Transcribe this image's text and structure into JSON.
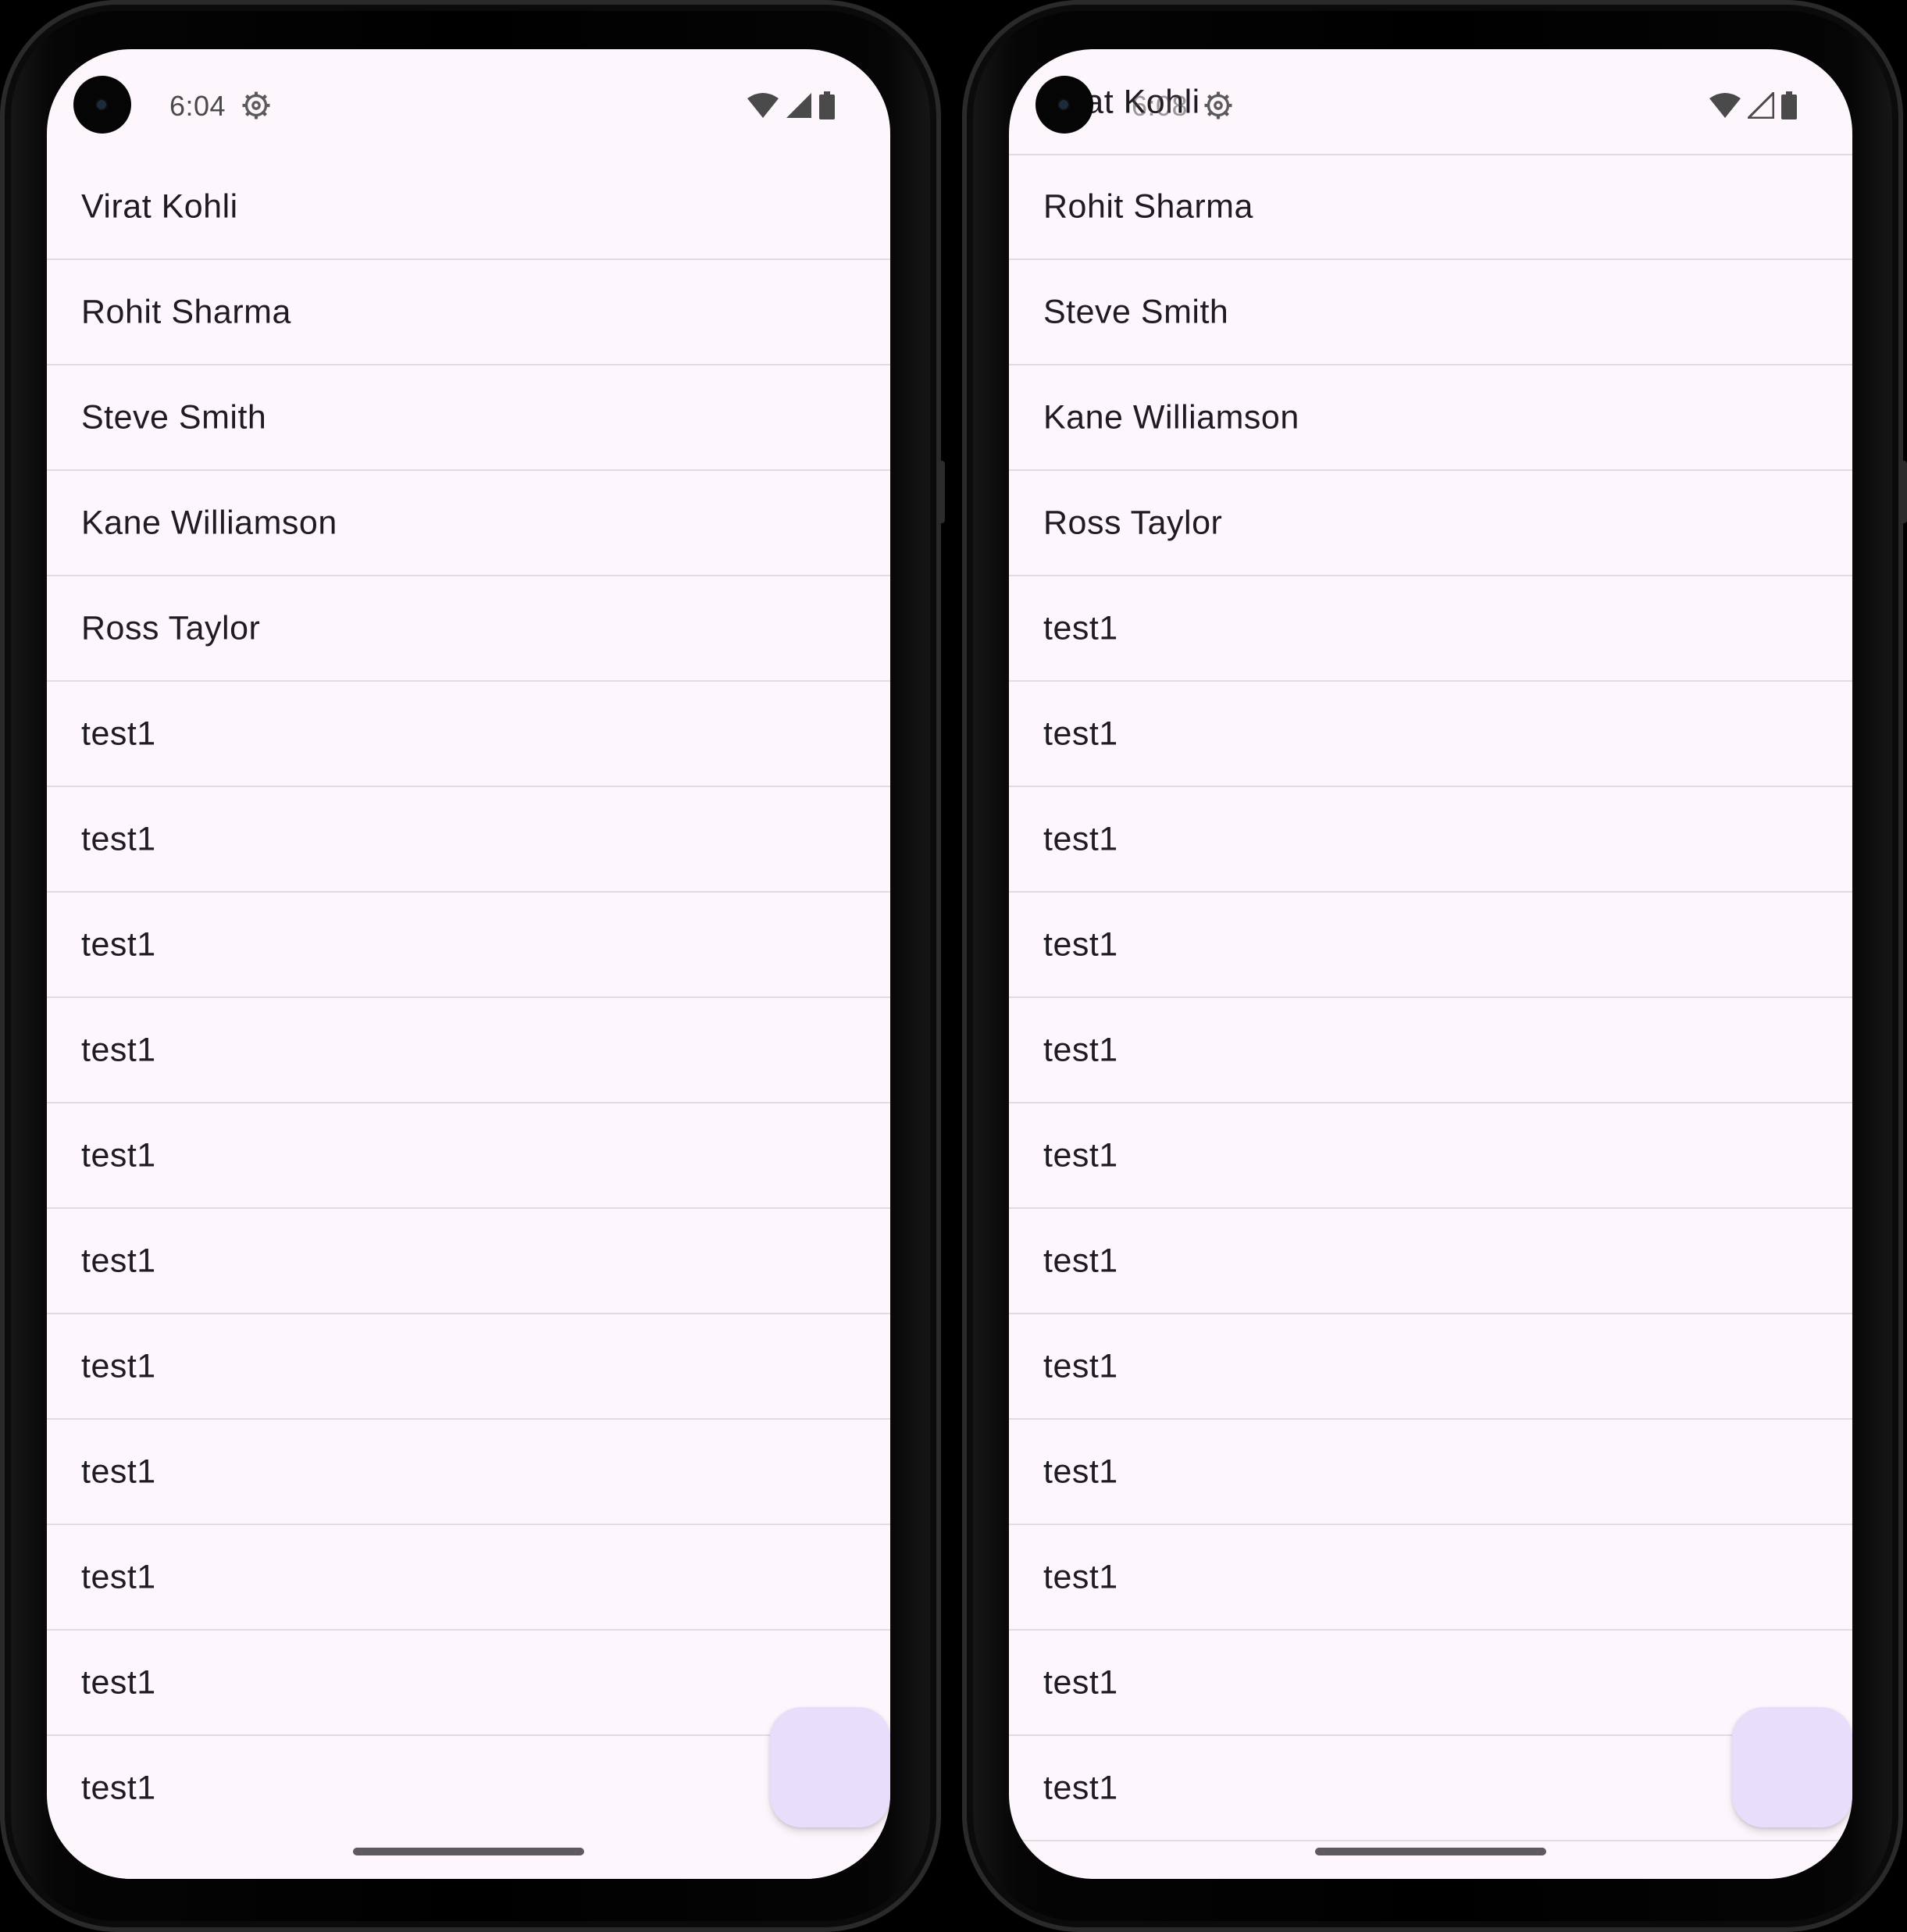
{
  "left_device": {
    "status": {
      "time": "6:04",
      "icons": [
        "camera-cutout",
        "settings-gear-icon",
        "wifi-icon",
        "cell-signal-icon",
        "battery-icon"
      ]
    },
    "list": [
      "Virat Kohli",
      "Rohit Sharma",
      "Steve Smith",
      "Kane Williamson",
      "Ross Taylor",
      "test1",
      "test1",
      "test1",
      "test1",
      "test1",
      "test1",
      "test1",
      "test1",
      "test1",
      "test1",
      "test1"
    ]
  },
  "right_device": {
    "status": {
      "time": "6:08",
      "icons": [
        "camera-cutout",
        "settings-gear-icon",
        "wifi-icon",
        "cell-signal-icon",
        "battery-icon"
      ]
    },
    "partial_header": "Virat Kohli",
    "list": [
      "Rohit Sharma",
      "Steve Smith",
      "Kane Williamson",
      "Ross Taylor",
      "test1",
      "test1",
      "test1",
      "test1",
      "test1",
      "test1",
      "test1",
      "test1",
      "test1",
      "test1",
      "test1",
      "test1"
    ]
  },
  "colors": {
    "screen_bg": "#FDF7FD",
    "divider": "#E1DCE2",
    "text": "#1E1B21",
    "fab": "#E8DDFA"
  }
}
